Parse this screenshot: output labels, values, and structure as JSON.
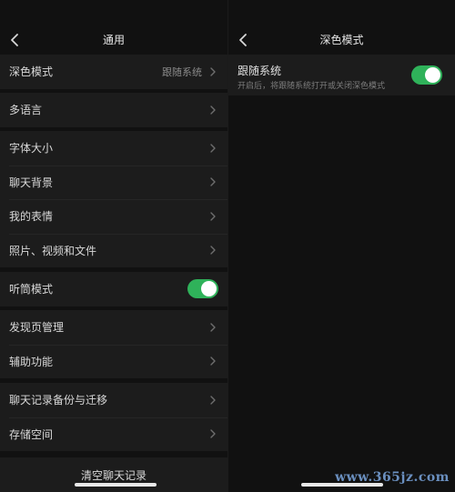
{
  "left": {
    "title": "通用",
    "dark_mode": {
      "label": "深色模式",
      "value": "跟随系统"
    },
    "language": {
      "label": "多语言"
    },
    "group_display": [
      {
        "label": "字体大小"
      },
      {
        "label": "聊天背景"
      },
      {
        "label": "我的表情"
      },
      {
        "label": "照片、视频和文件"
      }
    ],
    "earpiece": {
      "label": "听筒模式",
      "on": true
    },
    "group_features": [
      {
        "label": "发现页管理"
      },
      {
        "label": "辅助功能"
      }
    ],
    "group_storage": [
      {
        "label": "聊天记录备份与迁移"
      },
      {
        "label": "存储空间"
      }
    ],
    "clear_button": "清空聊天记录"
  },
  "right": {
    "title": "深色模式",
    "follow_system": {
      "label": "跟随系统",
      "description": "开启后，将跟随系统打开或关闭深色模式",
      "on": true
    }
  },
  "watermark": "www.365jz.com",
  "colors": {
    "toggle_on": "#2fb25a",
    "background": "#111111",
    "cell": "#1c1c1c"
  }
}
